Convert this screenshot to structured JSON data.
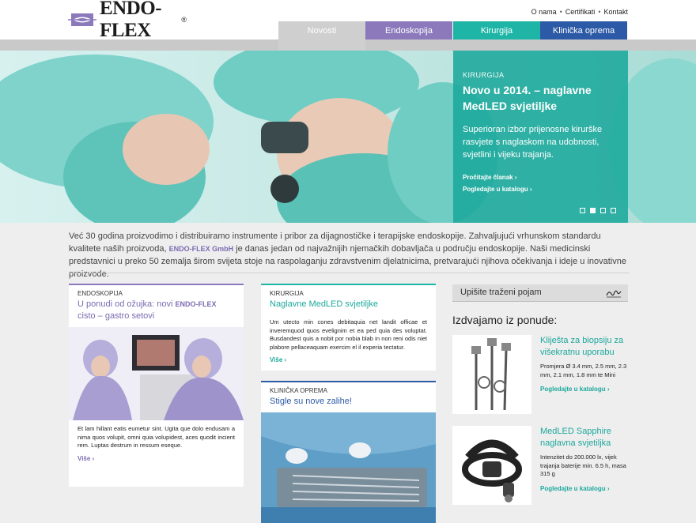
{
  "brand": {
    "name": "ENDO-FLEX",
    "reg": "®"
  },
  "toplinks": [
    "O nama",
    "Certifikati",
    "Kontakt"
  ],
  "toplinks_sep": "•",
  "nav": {
    "tabs": [
      "Novosti",
      "Endoskopija",
      "Kirurgija",
      "Klinička oprema"
    ]
  },
  "colors": {
    "endoskopija": "#8b79bc",
    "kirurgija": "#1eb5a6",
    "klinicka": "#2d5aa6",
    "novosti": "#cfcfcf"
  },
  "hero": {
    "category": "KIRURGIJA",
    "title": "Novo u 2014. – naglavne MedLED svjetiljke",
    "text": "Superioran izbor prijenosne kirurške rasvjete s naglaskom na udobnosti, svjetlini i vijeku trajanja.",
    "link1": "Pročitajte članak ›",
    "link2": "Pogledajte u katalogu ›",
    "active_slide": 2,
    "slides": 4
  },
  "intro": {
    "part1": "Već 30 godina proizvodimo i distribuiramo instrumente i pribor za dijagnostičke i terapijske endoskopije. Zahvaljujući vrhunskom standardu kvalitete naših proizvoda, ",
    "brand": "ENDO-FLEX GmbH",
    "part2": " je danas jedan od najvažnijih njemačkih dobavljača u području endoskopije. Naši medicinski predstavnici u preko 50 zemalja širom svijeta stoje na raspolaganju zdravstvenim djelatnicima, pretvarajući njihova očekivanja i ideje u inovativne proizvode."
  },
  "cards": {
    "endo": {
      "category": "ENDOSKOPIJA",
      "title_a": "U ponudi od ožujka: novi ",
      "title_brand": "ENDO-FLEX",
      "title_b": " cisto – gastro setovi",
      "body": "Et lam hillant eatis eumetur sint. Ugita que dolo endusam a nima quos volupit, omni quia volupidest, aces quodit incient rem. Luptas destrum in ressum eseque.",
      "more": "Više ›"
    },
    "kir": {
      "category": "KIRURGIJA",
      "title": "Naglavne MedLED svjetiljke",
      "body": "Um utecto min cones debitaquia net landit officae et inveremquod quos evelignim et ea ped quia des voluptat. Busdandest quis a nobit por nobia blab in non reni odis niet plabore pellaceaquam exercim el il experia tectatur.",
      "more": "Više ›"
    },
    "klin": {
      "category": "KLINIČKA OPREMA",
      "title": "Stigle su nove zalihe!"
    }
  },
  "sidebar": {
    "search_placeholder": "Upišite traženi pojam",
    "featured_title": "Izdvajamo iz ponude:",
    "products": [
      {
        "name": "Kliješta za biopsiju za višekratnu uporabu",
        "desc": "Promjera Ø 3.4 mm, 2.5 mm, 2.3 mm, 2.1 mm, 1.8 mm te Mini",
        "link": "Pogledajte u katalogu ›"
      },
      {
        "name": "MedLED Sapphire naglavna svjetiljka",
        "desc": "Intenzitet do 200.000 lx, vijek trajanja baterije min. 6.5 h, masa 315 g",
        "link": "Pogledajte u katalogu ›"
      }
    ]
  }
}
